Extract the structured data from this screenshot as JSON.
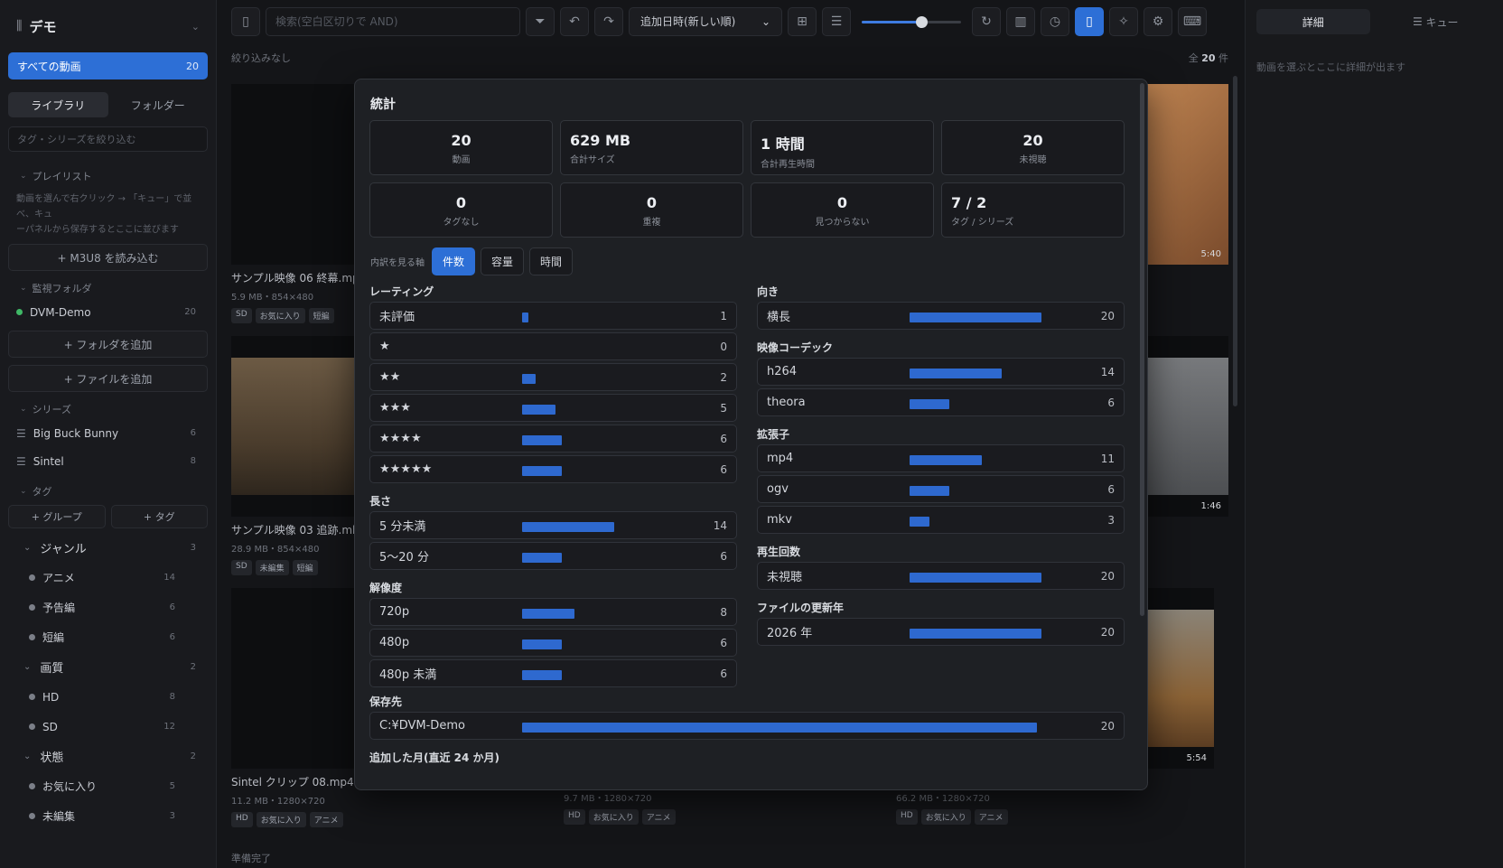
{
  "sidebar": {
    "library_name": "デモ",
    "all_videos": {
      "label": "すべての動画",
      "count": "20"
    },
    "tabs": [
      "ライブラリ",
      "フォルダー"
    ],
    "filter_placeholder": "タグ・シリーズを絞り込む",
    "playlist": {
      "title": "プレイリスト",
      "note": [
        "動画を選んで右クリック → 「キュー」で並べ、キュ",
        "ーパネルから保存するとここに並びます"
      ],
      "load_button": "+ M3U8 を読み込む"
    },
    "watch": {
      "title": "監視フォルダ",
      "folder": {
        "name": "DVM-Demo",
        "count": "20"
      },
      "add_folder": "+ フォルダを追加",
      "add_file": "+ ファイルを追加"
    },
    "series": {
      "title": "シリーズ",
      "items": [
        {
          "name": "Big Buck Bunny",
          "count": "6"
        },
        {
          "name": "Sintel",
          "count": "8"
        }
      ]
    },
    "tags": {
      "title": "タグ",
      "add_group": "+ グループ",
      "add_tag": "+ タグ",
      "groups": [
        {
          "name": "ジャンル",
          "count": "3",
          "items": [
            {
              "name": "アニメ",
              "count": "14"
            },
            {
              "name": "予告編",
              "count": "6"
            },
            {
              "name": "短編",
              "count": "6"
            }
          ]
        },
        {
          "name": "画質",
          "count": "2",
          "items": [
            {
              "name": "HD",
              "count": "8"
            },
            {
              "name": "SD",
              "count": "12"
            }
          ]
        },
        {
          "name": "状態",
          "count": "2",
          "items": [
            {
              "name": "お気に入り",
              "count": "5"
            },
            {
              "name": "未編集",
              "count": "3"
            }
          ]
        }
      ]
    }
  },
  "toolbar": {
    "search_placeholder": "検索(空白区切りで AND)",
    "sort_label": "追加日時(新しい順)",
    "zoom": 0.6
  },
  "subbar": {
    "filter_status": "絞り込みなし",
    "total_prefix": "全",
    "total": "20",
    "total_suffix": "件"
  },
  "cards": [
    {
      "title": "サンプル映像 06 終幕.mp4",
      "meta": "5.9 MB・854×480",
      "chips": [
        "SD",
        "お気に入り",
        "短編"
      ]
    },
    {
      "duration": "5:40"
    },
    {
      "title": "サンプル映像 03 追跡.mkv",
      "meta": "28.9 MB・854×480",
      "chips": [
        "SD",
        "未編集",
        "短編"
      ]
    },
    {
      "duration": "1:46"
    },
    {
      "title": "Sintel クリップ 08.mp4",
      "meta": "11.2 MB・1280×720",
      "chips": [
        "HD",
        "お気に入り",
        "アニメ"
      ]
    },
    {
      "meta": "9.7 MB・1280×720",
      "chips": [
        "HD",
        "お気に入り",
        "アニメ"
      ]
    },
    {
      "meta": "66.2 MB・1280×720",
      "chips": [
        "HD",
        "お気に入り",
        "アニメ"
      ],
      "duration": "5:54"
    }
  ],
  "status": "準備完了",
  "right_panel": {
    "tabs": [
      "詳細",
      "キュー"
    ],
    "hint": "動画を選ぶとここに詳細が出ます"
  },
  "stats": {
    "title": "統計",
    "cards": [
      {
        "value": "20",
        "label": "動画"
      },
      {
        "value": "629 MB",
        "label": "合計サイズ"
      },
      {
        "value": "1 時間",
        "label": "合計再生時間"
      },
      {
        "value": "20",
        "label": "未視聴"
      },
      {
        "value": "0",
        "label": "タグなし"
      },
      {
        "value": "0",
        "label": "重複"
      },
      {
        "value": "0",
        "label": "見つからない"
      },
      {
        "value": "7 / 2",
        "label": "タグ / シリーズ"
      }
    ],
    "axis": {
      "label": "内訳を見る軸",
      "options": [
        "件数",
        "容量",
        "時間"
      ],
      "selected": "件数"
    },
    "left_sections": [
      {
        "title": "レーティング",
        "rows": [
          {
            "label": "未評価",
            "count": 1
          },
          {
            "label": "★",
            "count": 0
          },
          {
            "label": "★★",
            "count": 2
          },
          {
            "label": "★★★",
            "count": 5
          },
          {
            "label": "★★★★",
            "count": 6
          },
          {
            "label": "★★★★★",
            "count": 6
          }
        ]
      },
      {
        "title": "長さ",
        "rows": [
          {
            "label": "5 分未満",
            "count": 14
          },
          {
            "label": "5〜20 分",
            "count": 6
          }
        ]
      },
      {
        "title": "解像度",
        "rows": [
          {
            "label": "720p",
            "count": 8
          },
          {
            "label": "480p",
            "count": 6
          },
          {
            "label": "480p 未満",
            "count": 6
          }
        ]
      }
    ],
    "right_sections": [
      {
        "title": "向き",
        "rows": [
          {
            "label": "横長",
            "count": 20
          }
        ]
      },
      {
        "title": "映像コーデック",
        "rows": [
          {
            "label": "h264",
            "count": 14
          },
          {
            "label": "theora",
            "count": 6
          }
        ]
      },
      {
        "title": "拡張子",
        "rows": [
          {
            "label": "mp4",
            "count": 11
          },
          {
            "label": "ogv",
            "count": 6
          },
          {
            "label": "mkv",
            "count": 3
          }
        ]
      },
      {
        "title": "再生回数",
        "rows": [
          {
            "label": "未視聴",
            "count": 20
          }
        ]
      },
      {
        "title": "ファイルの更新年",
        "rows": [
          {
            "label": "2026 年",
            "count": 20
          }
        ]
      }
    ],
    "full_sections": [
      {
        "title": "保存先",
        "rows": [
          {
            "label": "C:¥DVM-Demo",
            "count": 20
          }
        ]
      },
      {
        "title": "追加した月(直近 24 か月)",
        "rows": []
      }
    ]
  }
}
